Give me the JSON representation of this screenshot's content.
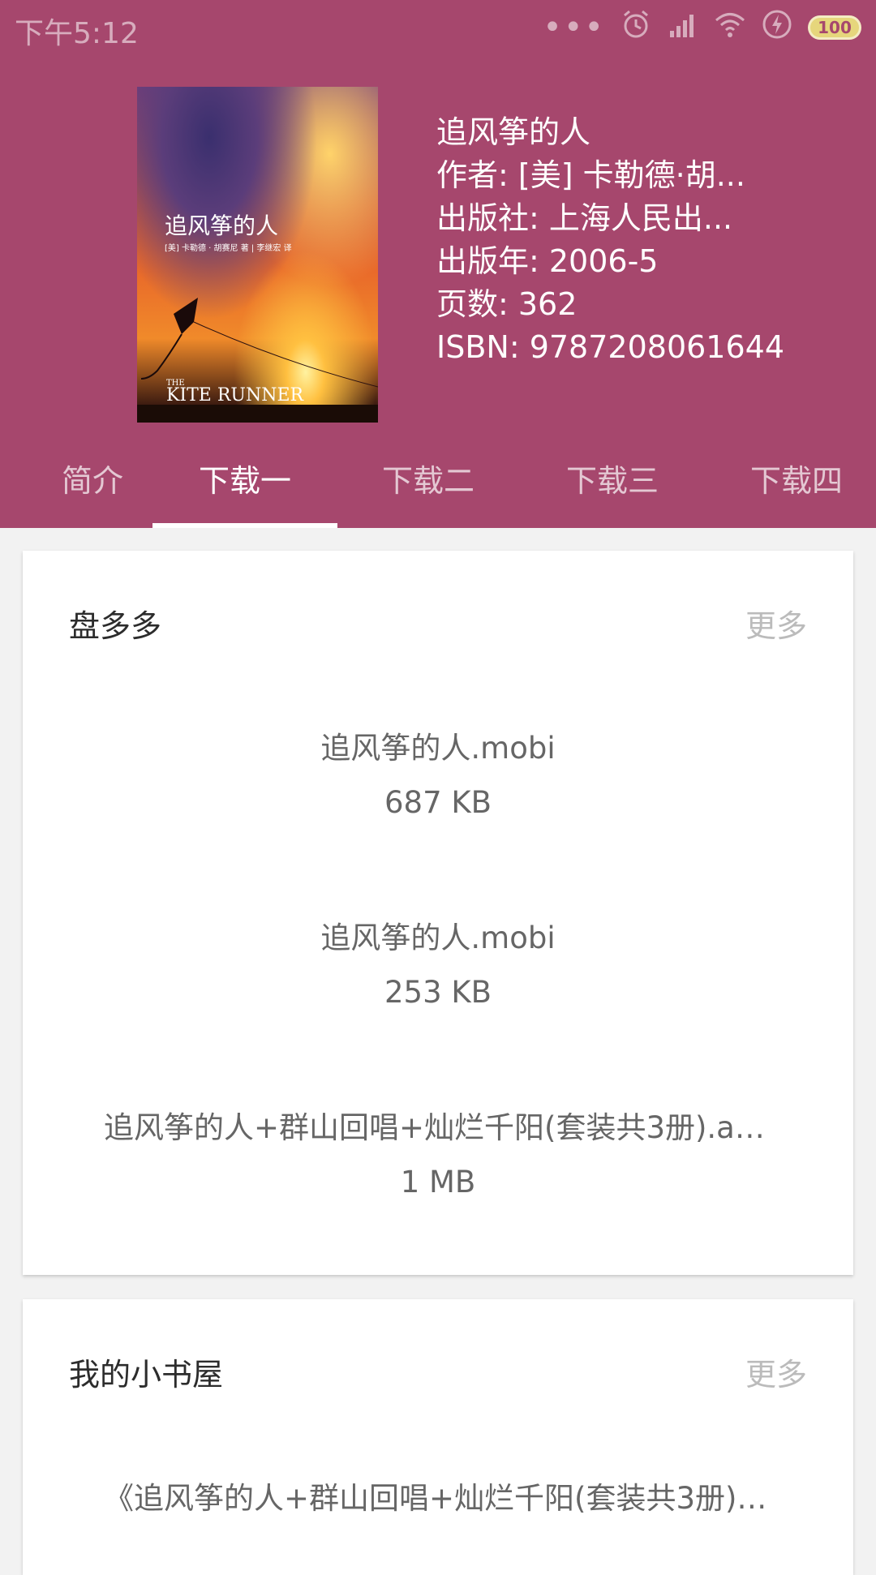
{
  "status_bar": {
    "time": "下午5:12",
    "dots": "•••",
    "battery": "100",
    "icons": [
      "alarm-icon",
      "hd-signal-icon",
      "wifi-icon",
      "charging-icon",
      "battery-icon"
    ]
  },
  "book": {
    "title": "追风筝的人",
    "author": "作者: [美] 卡勒德·胡...",
    "publisher": "出版社: 上海人民出...",
    "year": "出版年: 2006-5",
    "pages": "页数: 362",
    "isbn": "ISBN: 9787208061644",
    "cover": {
      "cn_title": "追风筝的人",
      "authors": "[美] 卡勒德 · 胡赛尼 著 | 李继宏 译",
      "en_title_small": "THE",
      "en_title": "KITE RUNNER"
    }
  },
  "tabs": [
    {
      "label": "简介"
    },
    {
      "label": "下载一"
    },
    {
      "label": "下载二"
    },
    {
      "label": "下载三"
    },
    {
      "label": "下载四"
    }
  ],
  "active_tab": "下载一",
  "sources": [
    {
      "name": "盘多多",
      "more": "更多",
      "files": [
        {
          "name": "追风筝的人.mobi",
          "size": "687 KB"
        },
        {
          "name": "追风筝的人.mobi",
          "size": "253 KB"
        },
        {
          "name": "追风筝的人+群山回唱+灿烂千阳(套装共3册).az...",
          "size": "1 MB"
        }
      ]
    },
    {
      "name": "我的小书屋",
      "more": "更多",
      "files": [
        {
          "name": "《追风筝的人+群山回唱+灿烂千阳(套装共3册)》..."
        }
      ]
    }
  ],
  "colors": {
    "header": "#a6476d",
    "text_muted": "#666666",
    "more": "#bbbbbb"
  }
}
